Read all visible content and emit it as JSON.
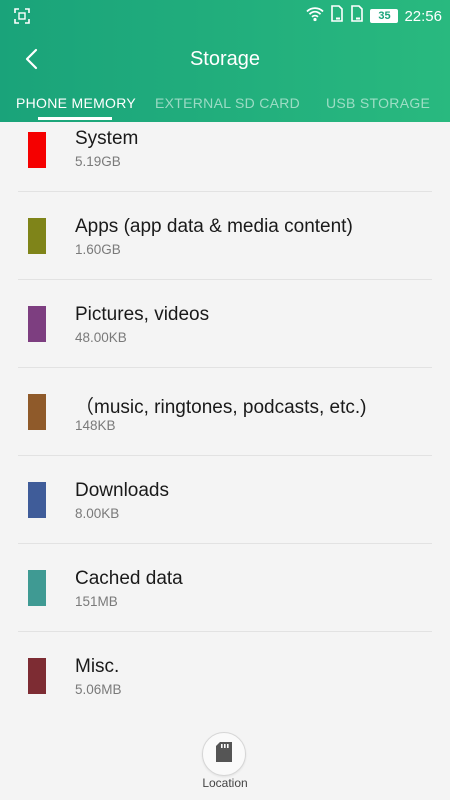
{
  "status_bar": {
    "battery": "35",
    "time": "22:56"
  },
  "header": {
    "title": "Storage"
  },
  "tabs": [
    {
      "label": "PHONE MEMORY",
      "active": true
    },
    {
      "label": "EXTERNAL SD CARD",
      "active": false
    },
    {
      "label": "USB STORAGE",
      "active": false
    }
  ],
  "storage_items": [
    {
      "title": "System",
      "size": "5.19GB",
      "color": "#f50000"
    },
    {
      "title": "Apps (app data & media content)",
      "size": "1.60GB",
      "color": "#7f8419"
    },
    {
      "title": "Pictures, videos",
      "size": "48.00KB",
      "color": "#7d3e80"
    },
    {
      "title": "（music, ringtones, podcasts, etc.)",
      "size": "148KB",
      "color": "#8f5a2a"
    },
    {
      "title": "Downloads",
      "size": "8.00KB",
      "color": "#3f5c99"
    },
    {
      "title": "Cached data",
      "size": "151MB",
      "color": "#3f9a93"
    },
    {
      "title": "Misc.",
      "size": "5.06MB",
      "color": "#7d2c33"
    }
  ],
  "location": {
    "label": "Location",
    "icon": "sd-card-icon"
  },
  "colors": {
    "header_accent": "#1aa37a",
    "background": "#f4f4f4"
  }
}
